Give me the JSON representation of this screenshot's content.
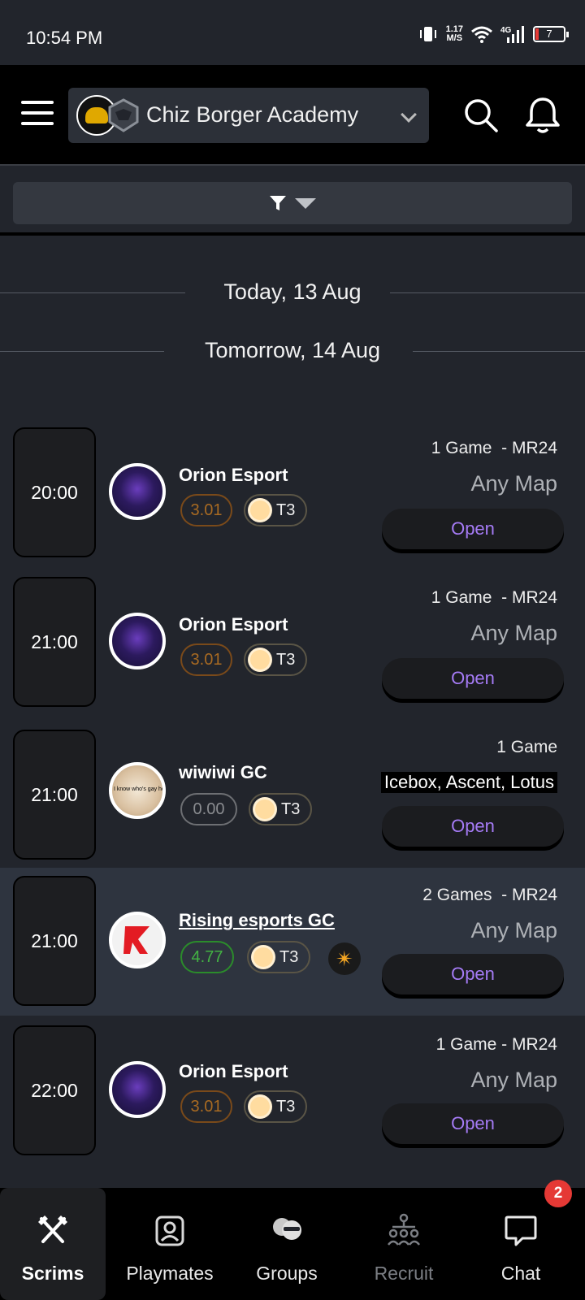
{
  "status_bar": {
    "time": "10:54 PM",
    "net_speed_value": "1.17",
    "net_speed_unit": "M/S",
    "network": "4G",
    "battery": "7"
  },
  "header": {
    "team_name": "Chiz Borger Academy"
  },
  "dates": {
    "today": "Today, 13 Aug",
    "tomorrow": "Tomorrow, 14 Aug"
  },
  "scrims": [
    {
      "time": "20:00",
      "team": "Orion Esport",
      "rating": "3.01",
      "tier": "T3",
      "games": "1 Game  - MR24",
      "map": "Any Map",
      "action": "Open"
    },
    {
      "time": "21:00",
      "team": "Orion Esport",
      "rating": "3.01",
      "tier": "T3",
      "games": "1 Game  - MR24",
      "map": "Any Map",
      "action": "Open"
    },
    {
      "time": "21:00",
      "team": "wiwiwi GC",
      "rating": "0.00",
      "tier": "T3",
      "games": "1 Game",
      "map": "Icebox, Ascent, Lotus",
      "action": "Open"
    },
    {
      "time": "21:00",
      "team": "Rising esports GC",
      "rating": "4.77",
      "tier": "T3",
      "games": "2 Games  - MR24",
      "map": "Any Map",
      "action": "Open"
    },
    {
      "time": "22:00",
      "team": "Orion Esport",
      "rating": "3.01",
      "tier": "T3",
      "games": "1 Game - MR24",
      "map": "Any Map",
      "action": "Open"
    }
  ],
  "nav": {
    "scrims": "Scrims",
    "playmates": "Playmates",
    "groups": "Groups",
    "recruit": "Recruit",
    "chat": "Chat",
    "chat_badge": "2"
  },
  "colors": {
    "accent_purple": "#a57bf5",
    "rating_orange": "#a86a22",
    "rating_green": "#43b243",
    "badge_red": "#e53935"
  }
}
